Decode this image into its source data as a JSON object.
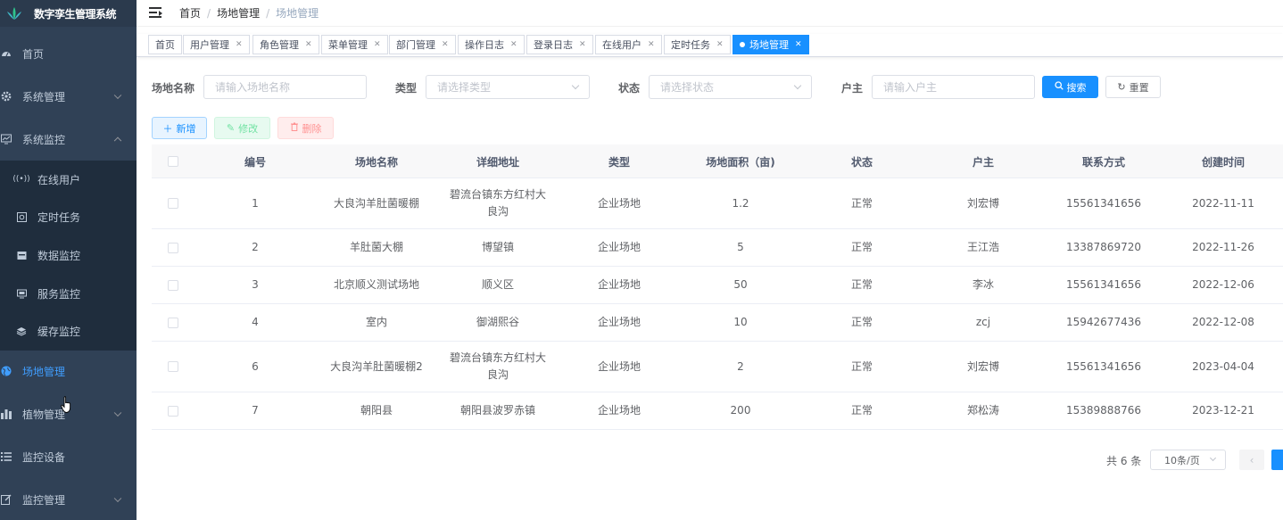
{
  "app": {
    "title": "数字孪生管理系统"
  },
  "sidebar": {
    "items": [
      {
        "label": "首页",
        "icon": "dashboard-icon"
      },
      {
        "label": "系统管理",
        "icon": "gear-icon"
      },
      {
        "label": "系统监控",
        "icon": "monitor-icon"
      },
      {
        "label": "场地管理",
        "icon": "globe-icon"
      },
      {
        "label": "植物管理",
        "icon": "bar-chart-icon"
      },
      {
        "label": "监控设备",
        "icon": "list-icon"
      },
      {
        "label": "监控管理",
        "icon": "edit-icon"
      }
    ],
    "submenu": [
      {
        "label": "在线用户",
        "icon": "online-icon"
      },
      {
        "label": "定时任务",
        "icon": "job-icon"
      },
      {
        "label": "数据监控",
        "icon": "druid-icon"
      },
      {
        "label": "服务监控",
        "icon": "server-icon"
      },
      {
        "label": "缓存监控",
        "icon": "redis-icon"
      }
    ]
  },
  "breadcrumb": [
    "首页",
    "场地管理",
    "场地管理"
  ],
  "tags": [
    "首页",
    "用户管理",
    "角色管理",
    "菜单管理",
    "部门管理",
    "操作日志",
    "登录日志",
    "在线用户",
    "定时任务",
    "场地管理"
  ],
  "search": {
    "name_label": "场地名称",
    "name_placeholder": "请输入场地名称",
    "type_label": "类型",
    "type_placeholder": "请选择类型",
    "status_label": "状态",
    "status_placeholder": "请选择状态",
    "owner_label": "户主",
    "owner_placeholder": "请输入户主",
    "search_button": "搜索",
    "reset_button": "重置"
  },
  "toolbar": {
    "add": "新增",
    "edit": "修改",
    "delete": "删除"
  },
  "table": {
    "columns": [
      "编号",
      "场地名称",
      "详细地址",
      "类型",
      "场地面积（亩)",
      "状态",
      "户主",
      "联系方式",
      "创建时间"
    ],
    "rows": [
      {
        "id": "1",
        "name": "大良沟羊肚菌暖棚",
        "address": "碧流台镇东方红村大良沟",
        "type": "企业场地",
        "area": "1.2",
        "status": "正常",
        "owner": "刘宏博",
        "phone": "15561341656",
        "created": "2022-11-11"
      },
      {
        "id": "2",
        "name": "羊肚菌大棚",
        "address": "博望镇",
        "type": "企业场地",
        "area": "5",
        "status": "正常",
        "owner": "王江浩",
        "phone": "13387869720",
        "created": "2022-11-26"
      },
      {
        "id": "3",
        "name": "北京顺义测试场地",
        "address": "顺义区",
        "type": "企业场地",
        "area": "50",
        "status": "正常",
        "owner": "李冰",
        "phone": "15561341656",
        "created": "2022-12-06"
      },
      {
        "id": "4",
        "name": "室内",
        "address": "御湖熙谷",
        "type": "企业场地",
        "area": "10",
        "status": "正常",
        "owner": "zcj",
        "phone": "15942677436",
        "created": "2022-12-08"
      },
      {
        "id": "6",
        "name": "大良沟羊肚菌暖棚2",
        "address": "碧流台镇东方红村大良沟",
        "type": "企业场地",
        "area": "2",
        "status": "正常",
        "owner": "刘宏博",
        "phone": "15561341656",
        "created": "2023-04-04"
      },
      {
        "id": "7",
        "name": "朝阳县",
        "address": "朝阳县波罗赤镇",
        "type": "企业场地",
        "area": "200",
        "status": "正常",
        "owner": "郑松涛",
        "phone": "15389888766",
        "created": "2023-12-21"
      }
    ]
  },
  "pagination": {
    "total": "共 6 条",
    "page_size": "10条/页"
  },
  "colors": {
    "sidebar_bg": "#304156",
    "accent": "#1890ff",
    "active_menu": "#409eff"
  }
}
